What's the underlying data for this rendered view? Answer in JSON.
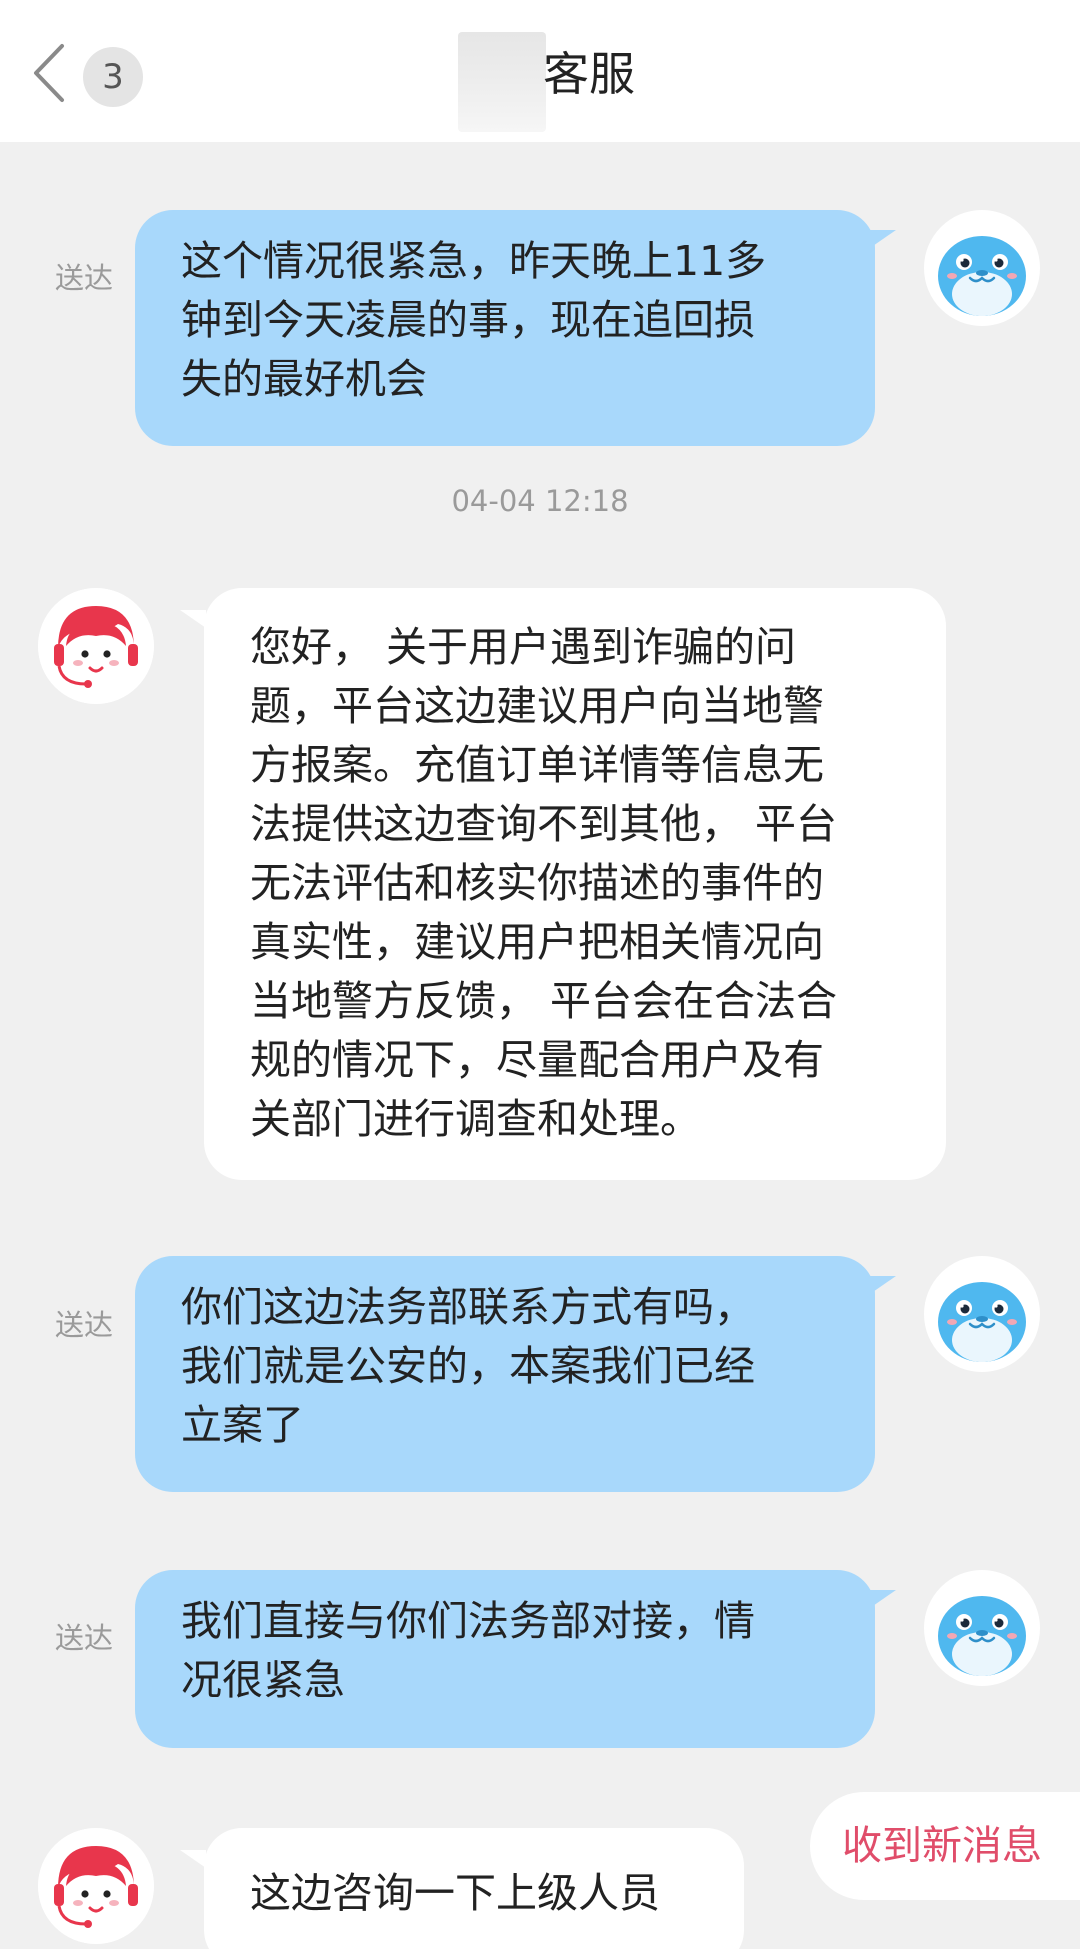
{
  "header": {
    "unread_count": "3",
    "title": "客服"
  },
  "messages": [
    {
      "direction": "sent",
      "status": "送达",
      "text": "这个情况很紧急，昨天晚上11多\n钟到今天凌晨的事，现在追回损\n失的最好机会"
    },
    {
      "direction": "received",
      "text": "您好， 关于用户遇到诈骗的问\n题，平台这边建议用户向当地警\n方报案。充值订单详情等信息无\n法提供这边查询不到其他， 平台\n无法评估和核实你描述的事件的\n真实性，建议用户把相关情况向\n当地警方反馈， 平台会在合法合\n规的情况下，尽量配合用户及有\n关部门进行调查和处理。"
    },
    {
      "direction": "sent",
      "status": "送达",
      "text": "你们这边法务部联系方式有吗，\n我们就是公安的，本案我们已经\n立案了"
    },
    {
      "direction": "sent",
      "status": "送达",
      "text": "我们直接与你们法务部对接，情\n况很紧急"
    },
    {
      "direction": "received",
      "text": "这边咨询一下上级人员"
    }
  ],
  "timestamp": "04-04 12:18",
  "new_message_button": "收到新消息",
  "colors": {
    "sent_bubble": "#a8d8fb",
    "received_bubble": "#ffffff",
    "background": "#f0f0f0",
    "new_message_text": "#e04d6a",
    "agent_avatar": "#e8364c",
    "user_avatar": "#4fb8ef"
  },
  "icons": {
    "back": "chevron-left-icon",
    "agent_avatar": "customer-service-avatar-icon",
    "user_avatar": "blue-seal-avatar-icon"
  }
}
